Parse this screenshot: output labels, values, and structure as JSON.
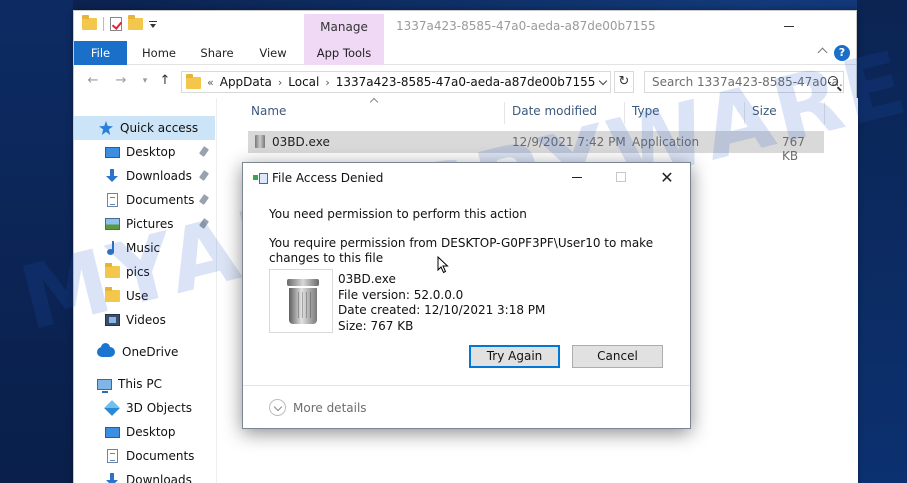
{
  "explorer": {
    "window_title": "1337a423-8585-47a0-aeda-a87de00b7155",
    "context_tab": "Manage",
    "ribbon_tabs": [
      "File",
      "Home",
      "Share",
      "View",
      "App Tools"
    ],
    "address": {
      "overflow": "«",
      "crumbs": [
        "AppData",
        "Local",
        "1337a423-8585-47a0-aeda-a87de00b7155"
      ]
    },
    "search_placeholder": "Search 1337a423-8585-47a0-a...",
    "sidebar": {
      "quick_access": "Quick access",
      "items": [
        {
          "label": "Desktop",
          "icon": "desktop-icon",
          "pinned": true
        },
        {
          "label": "Downloads",
          "icon": "download-icon",
          "pinned": true
        },
        {
          "label": "Documents",
          "icon": "document-icon",
          "pinned": true
        },
        {
          "label": "Pictures",
          "icon": "picture-icon",
          "pinned": true
        },
        {
          "label": "Music",
          "icon": "music-icon",
          "pinned": false
        },
        {
          "label": "pics",
          "icon": "folder-icon",
          "pinned": false
        },
        {
          "label": "Use",
          "icon": "folder-icon",
          "pinned": false
        },
        {
          "label": "Videos",
          "icon": "video-icon",
          "pinned": false
        }
      ],
      "onedrive": "OneDrive",
      "this_pc": "This PC",
      "pc_items": [
        {
          "label": "3D Objects",
          "icon": "cube-icon"
        },
        {
          "label": "Desktop",
          "icon": "desktop-icon"
        },
        {
          "label": "Documents",
          "icon": "document-icon"
        },
        {
          "label": "Downloads",
          "icon": "download-icon"
        }
      ]
    },
    "columns": [
      "Name",
      "Date modified",
      "Type",
      "Size"
    ],
    "files": [
      {
        "name": "03BD.exe",
        "date_modified": "12/9/2021 7:42 PM",
        "type": "Application",
        "size": "767 KB"
      }
    ]
  },
  "dialog": {
    "title": "File Access Denied",
    "heading": "You need permission to perform this action",
    "message": "You require permission from DESKTOP-G0PF3PF\\User10 to make changes to this file",
    "file": {
      "name": "03BD.exe",
      "version": "File version: 52.0.0.0",
      "created": "Date created: 12/10/2021 3:18 PM",
      "size": "Size: 767 KB"
    },
    "try_again": "Try Again",
    "cancel": "Cancel",
    "more_details": "More details"
  },
  "watermark": "MYANTISPYWARE.COM",
  "colors": {
    "accent": "#1a6fc8",
    "manage_tab": "#f0d9f5",
    "selection": "#cce4f7",
    "default_button_border": "#0078d7"
  }
}
